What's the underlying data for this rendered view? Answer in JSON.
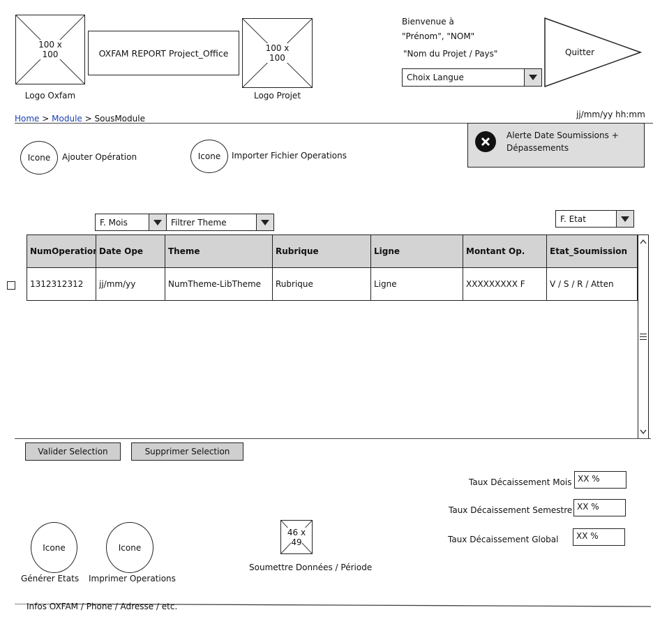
{
  "header": {
    "logo_oxfam": {
      "placeholder": "100 x 100",
      "caption": "Logo Oxfam"
    },
    "app_title": "OXFAM REPORT Project_Office",
    "logo_projet": {
      "placeholder": "100 x 100",
      "caption": "Logo Projet"
    },
    "welcome": "Bienvenue à",
    "user_name": "\"Prénom\", \"NOM\"",
    "project_country": "\"Nom du Projet / Pays\"",
    "language_select": "Choix Langue",
    "quit_label": "Quitter"
  },
  "breadcrumb": {
    "home": "Home",
    "module": "Module",
    "submodule": "SousModule",
    "separator": ">"
  },
  "datetime": "jj/mm/yy hh:mm",
  "alert": {
    "text_line1": "Alerte Date Soumissions  +",
    "text_line2": "Dépassements"
  },
  "actions": {
    "add": {
      "icon": "Icone",
      "label": "Ajouter Opération"
    },
    "import": {
      "icon": "Icone",
      "label": "Importer Fichier Operations"
    }
  },
  "filters": {
    "month": "F. Mois",
    "theme": "Filtrer Theme",
    "state": "F. Etat"
  },
  "table": {
    "columns": [
      "NumOperation",
      "Date Ope",
      "Theme",
      "Rubrique",
      "Ligne",
      "Montant Op.",
      "Etat_Soumission"
    ],
    "rows": [
      [
        "1312312312",
        "jj/mm/yy",
        "NumTheme-LibTheme",
        "Rubrique",
        "Ligne",
        "XXXXXXXXX F",
        "V / S / R / Atten"
      ]
    ]
  },
  "buttons": {
    "validate": "Valider Selection",
    "delete": "Supprimer Selection"
  },
  "rates": [
    {
      "label": "Taux Décaissement Mois",
      "value": "XX %"
    },
    {
      "label": "Taux Décaissement Semestre",
      "value": "XX %"
    },
    {
      "label": "Taux Décaissement Global",
      "value": "XX %"
    }
  ],
  "bottom_actions": {
    "generate": {
      "icon": "Icone",
      "label": "Générer Etats"
    },
    "print": {
      "icon": "Icone",
      "label": "Imprimer Operations"
    },
    "submit": {
      "placeholder": "46 x 49",
      "label": "Soumettre Données / Période"
    }
  },
  "footer": "Infos OXFAM / Phone / Adresse / etc."
}
